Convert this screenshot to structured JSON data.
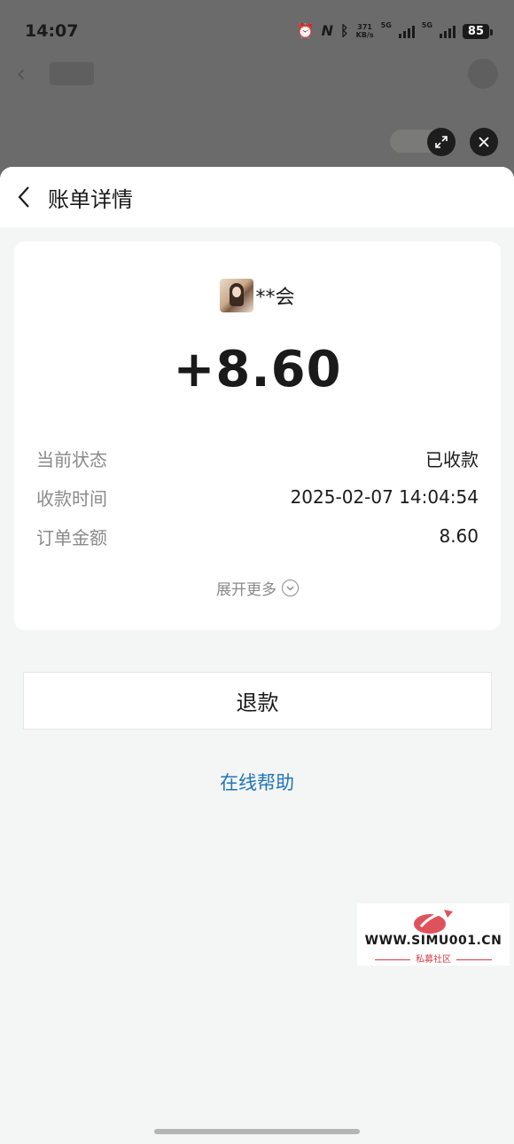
{
  "status_bar": {
    "time": "14:07",
    "net_speed": "371",
    "net_unit": "KB/s",
    "sim1": "5G",
    "sim2": "5G",
    "battery": "85"
  },
  "sheet": {
    "title": "账单详情"
  },
  "bill": {
    "payer_name": "**会",
    "amount": "+8.60",
    "rows": [
      {
        "label": "当前状态",
        "value": "已收款"
      },
      {
        "label": "收款时间",
        "value": "2025-02-07 14:04:54"
      },
      {
        "label": "订单金额",
        "value": "8.60"
      }
    ],
    "expand_label": "展开更多"
  },
  "actions": {
    "refund_label": "退款",
    "help_label": "在线帮助"
  },
  "watermark": {
    "url": "WWW.SIMU001.CN",
    "sub": "私募社区"
  },
  "colors": {
    "link": "#1f76b8",
    "background": "#f4f5f5",
    "card": "#ffffff"
  }
}
